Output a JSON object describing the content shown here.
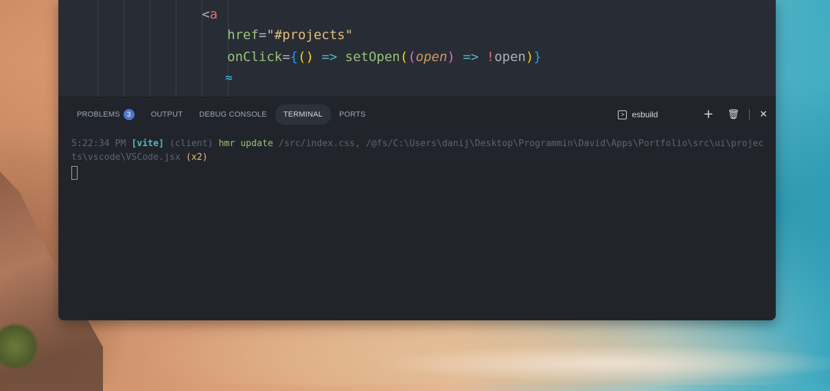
{
  "editor": {
    "lines": [
      {
        "open": "<",
        "tag": "a"
      },
      {
        "attr": "href",
        "eq": "=",
        "value": "\"#projects\""
      },
      {
        "attr": "onClick",
        "eq": "=",
        "b1": "{",
        "p1": "(",
        "p2": ")",
        "arrow1": " => ",
        "fn": "setOpen",
        "p3": "(",
        "p4": "(",
        "param": "open",
        "p5": ")",
        "arrow2": " => ",
        "bang": "!",
        "ident": "open",
        "p6": ")",
        "b2": "}"
      },
      {
        "icon": "tailwind-icon",
        "glyph": "≈"
      }
    ]
  },
  "panel": {
    "tabs": [
      {
        "label": "PROBLEMS",
        "badge": "3"
      },
      {
        "label": "OUTPUT"
      },
      {
        "label": "DEBUG CONSOLE"
      },
      {
        "label": "TERMINAL",
        "active": true
      },
      {
        "label": "PORTS"
      }
    ],
    "terminal_name": "esbuild",
    "terminal_icon": ">",
    "actions": {
      "add": "+",
      "trash": "🗑",
      "close": "✕"
    }
  },
  "terminal": {
    "time": "5:22:34 PM",
    "tag": "[vite]",
    "client": "(client)",
    "action": "hmr update",
    "path": "/src/index.css, /@fs/C:\\Users\\danij\\Desktop\\Programmin\\David\\Apps\\Portfolio\\src\\ui\\projects\\vscode\\VSCode.jsx",
    "count": "(x2)"
  },
  "colors": {
    "editor_bg": "#282c34",
    "panel_bg": "#21252b",
    "accent": "#4d78cc"
  }
}
